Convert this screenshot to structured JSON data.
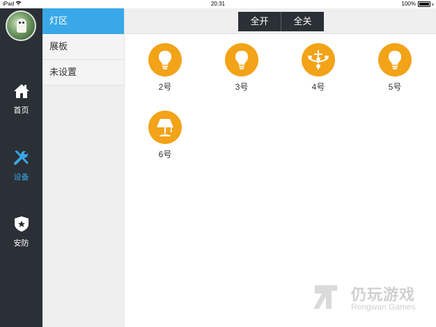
{
  "status_bar": {
    "device": "iPad",
    "time": "20:31",
    "battery": "100%"
  },
  "left_nav": {
    "items": [
      {
        "label": "首页",
        "icon": "home-icon",
        "active": false
      },
      {
        "label": "设备",
        "icon": "tools-icon",
        "active": true
      },
      {
        "label": "安防",
        "icon": "shield-icon",
        "active": false
      }
    ],
    "active_color": "#3aa8e8",
    "background": "#2b3036"
  },
  "categories": [
    {
      "label": "灯区",
      "active": true
    },
    {
      "label": "展板",
      "active": false
    },
    {
      "label": "未设置",
      "active": false
    }
  ],
  "toolbar": {
    "all_on_label": "全开",
    "all_off_label": "全关"
  },
  "devices": [
    {
      "label": "2号",
      "icon": "bulb-icon"
    },
    {
      "label": "3号",
      "icon": "bulb-icon"
    },
    {
      "label": "4号",
      "icon": "chandelier-icon"
    },
    {
      "label": "5号",
      "icon": "bulb-icon"
    },
    {
      "label": "6号",
      "icon": "table-lamp-icon"
    }
  ],
  "device_color": "#f2a317",
  "watermark": {
    "cn": "仍玩游戏",
    "en": "Rengwan Games"
  }
}
